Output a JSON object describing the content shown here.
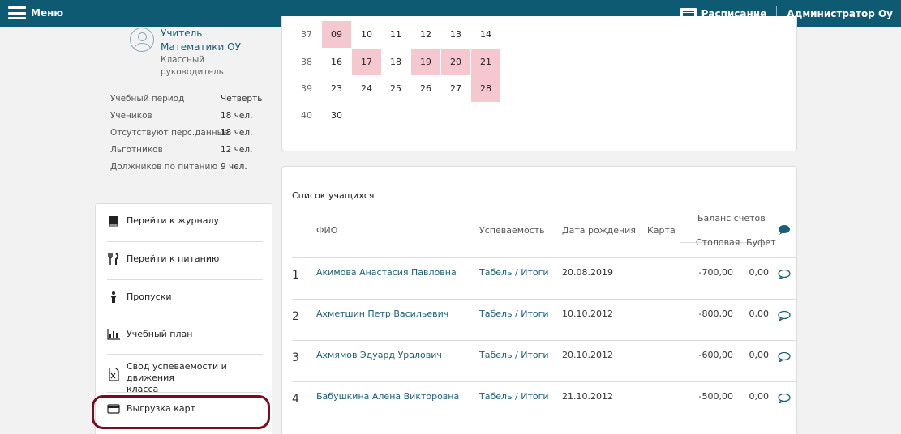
{
  "topbar": {
    "menu_label": "Меню",
    "schedule_label": "Расписание",
    "user_label": "Администратор Оу"
  },
  "profile": {
    "name_line1": "Учитель",
    "name_line2": "Математики ОУ",
    "role_line1": "Классный",
    "role_line2": "руководитель"
  },
  "stats": [
    {
      "label": "Учебный период",
      "value": "Четверть"
    },
    {
      "label": "Учеников",
      "value": "18 чел."
    },
    {
      "label": "Отсутствуют перс.данные",
      "value": "18 чел."
    },
    {
      "label": "Льготников",
      "value": "12 чел."
    },
    {
      "label": "Должников по питанию",
      "value": "9 чел."
    }
  ],
  "nav": [
    {
      "label": "Перейти к журналу",
      "icon": "book-icon"
    },
    {
      "label": "Перейти к питанию",
      "icon": "fork-knife-icon"
    },
    {
      "label": "Пропуски",
      "icon": "person-icon"
    },
    {
      "label": "Учебный план",
      "icon": "bar-chart-icon"
    },
    {
      "label": "Свод успеваемости и движения",
      "label2": "класса",
      "icon": "excel-file-icon"
    },
    {
      "label": "Выгрузка карт",
      "icon": "credit-card-icon"
    }
  ],
  "calendar": {
    "weeks": [
      {
        "week": "37",
        "days": [
          {
            "d": "09",
            "hl": true
          },
          {
            "d": "10"
          },
          {
            "d": "11"
          },
          {
            "d": "12"
          },
          {
            "d": "13"
          },
          {
            "d": "14"
          }
        ]
      },
      {
        "week": "38",
        "days": [
          {
            "d": "16"
          },
          {
            "d": "17",
            "hl": true
          },
          {
            "d": "18"
          },
          {
            "d": "19",
            "hl": true
          },
          {
            "d": "20",
            "hl": true
          },
          {
            "d": "21",
            "hl": true
          }
        ]
      },
      {
        "week": "39",
        "days": [
          {
            "d": "23"
          },
          {
            "d": "24"
          },
          {
            "d": "25"
          },
          {
            "d": "26"
          },
          {
            "d": "27"
          },
          {
            "d": "28",
            "hl": true
          }
        ]
      },
      {
        "week": "40",
        "days": [
          {
            "d": "30"
          }
        ]
      }
    ],
    "highlight_color": "#f5c8cf"
  },
  "students": {
    "title": "Список учащихся",
    "headers": {
      "fio": "ФИО",
      "progress": "Успеваемость",
      "birth": "Дата рождения",
      "card": "Карта",
      "balance": "Баланс счетов",
      "canteen": "Столовая",
      "buffet": "Буфет"
    },
    "rows": [
      {
        "n": "1",
        "name": "Акимова Анастасия Павловна",
        "progress": "Табель / Итоги",
        "birth": "20.08.2019",
        "canteen": "-700,00",
        "buffet": "0,00"
      },
      {
        "n": "2",
        "name": "Ахметшин Петр Васильевич",
        "progress": "Табель / Итоги",
        "birth": "10.10.2012",
        "canteen": "-800,00",
        "buffet": "0,00"
      },
      {
        "n": "3",
        "name": "Ахмямов Эдуард Уралович",
        "progress": "Табель / Итоги",
        "birth": "20.10.2012",
        "canteen": "-600,00",
        "buffet": "0,00"
      },
      {
        "n": "4",
        "name": "Бабушкина Алена Викторовна",
        "progress": "Табель / Итоги",
        "birth": "21.10.2012",
        "canteen": "-500,00",
        "buffet": "0,00"
      }
    ]
  },
  "colors": {
    "topbar": "#0f5a73",
    "link": "#1a5f7a",
    "highlight_oval": "#7a0c1e"
  }
}
